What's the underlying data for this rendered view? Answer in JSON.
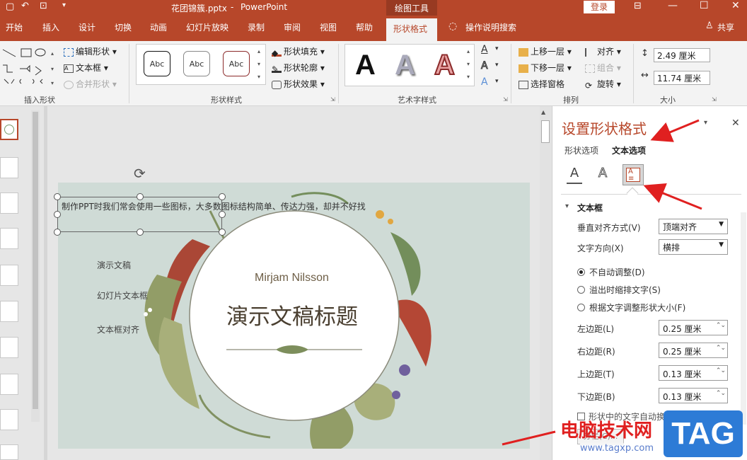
{
  "titlebar": {
    "filename": "花团锦簇.pptx",
    "app": "PowerPoint",
    "tool_context": "绘图工具",
    "login": "登录"
  },
  "tabs": [
    "开始",
    "插入",
    "设计",
    "切换",
    "动画",
    "幻灯片放映",
    "录制",
    "审阅",
    "视图",
    "帮助",
    "形状格式"
  ],
  "tell_me": "操作说明搜索",
  "share": "共享",
  "ribbon": {
    "insert_shapes": {
      "edit_shape": "编辑形状",
      "textbox": "文本框",
      "merge": "合并形状",
      "group_label": "插入形状"
    },
    "shape_styles": {
      "abc": [
        "Abc",
        "Abc",
        "Abc"
      ],
      "fill": "形状填充",
      "outline": "形状轮廓",
      "effects": "形状效果",
      "group_label": "形状样式"
    },
    "wordart": {
      "letters": [
        "A",
        "A",
        "A"
      ],
      "group_label": "艺术字样式"
    },
    "arrange": {
      "bring_forward": "上移一层",
      "send_backward": "下移一层",
      "selection_pane": "选择窗格",
      "align": "对齐",
      "group": "组合",
      "rotate": "旋转",
      "group_label": "排列"
    },
    "size": {
      "height": "2.49 厘米",
      "width": "11.74 厘米",
      "group_label": "大小"
    }
  },
  "slide": {
    "textbox_text": "制作PPT时我们常会使用一些图标，大多数图标结构简单、传达力强，却并不好找",
    "list": [
      "演示文稿",
      "幻灯片文本框",
      "文本框对齐"
    ],
    "author": "Mirjam Nilsson",
    "title": "演示文稿标题"
  },
  "pane": {
    "title": "设置形状格式",
    "tab_shape": "形状选项",
    "tab_text": "文本选项",
    "section": "文本框",
    "valign_label": "垂直对齐方式(V)",
    "valign_value": "顶端对齐",
    "dir_label": "文字方向(X)",
    "dir_value": "横排",
    "autofit_options": [
      "不自动调整(D)",
      "溢出时缩排文字(S)",
      "根据文字调整形状大小(F)"
    ],
    "margins": [
      {
        "label": "左边距(L)",
        "value": "0.25 厘米"
      },
      {
        "label": "右边距(R)",
        "value": "0.25 厘米"
      },
      {
        "label": "上边距(T)",
        "value": "0.13 厘米"
      },
      {
        "label": "下边距(B)",
        "value": "0.13 厘米"
      }
    ],
    "wrap_text": "形状中的文字自动换行(W)",
    "columns": "分栏(C)..."
  },
  "watermark": {
    "site_name": "电脑技术网",
    "url": "www.tagxp.com",
    "logo": "TAG"
  },
  "colors": {
    "accent": "#b7472a",
    "arrow": "#e02020"
  }
}
